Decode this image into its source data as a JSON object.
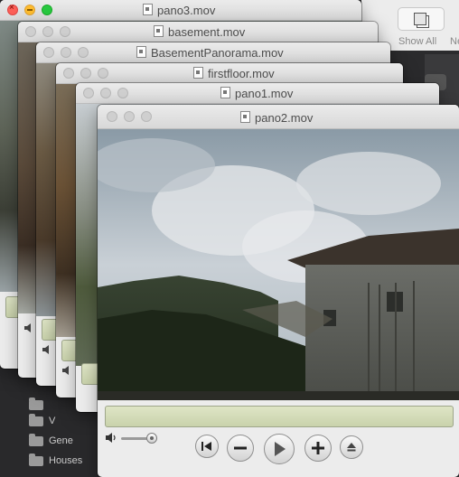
{
  "finder": {
    "toolbar_labels": [
      "Show All",
      "Ne"
    ],
    "sidebar_folders": [
      "V",
      "Gene",
      "Houses"
    ]
  },
  "windows": [
    {
      "title": "pano3.mov"
    },
    {
      "title": "basement.mov"
    },
    {
      "title": "BasementPanorama.mov"
    },
    {
      "title": "firstfloor.mov"
    },
    {
      "title": "pano1.mov"
    },
    {
      "title": "pano2.mov"
    }
  ],
  "player": {
    "volume_level": 0.85,
    "controls": [
      "go-to-start",
      "volume-down",
      "play",
      "volume-up",
      "eject"
    ]
  }
}
